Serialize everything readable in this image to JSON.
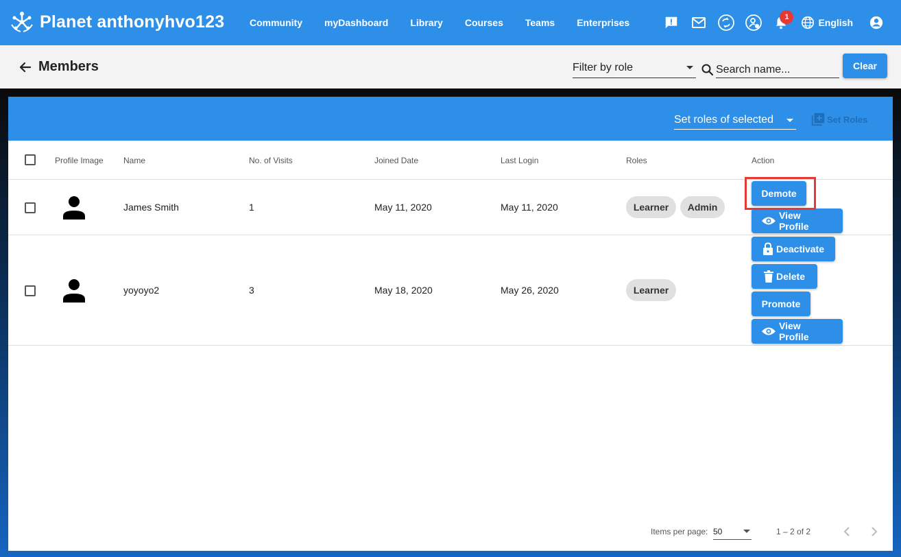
{
  "navbar": {
    "title": "Planet anthonyhvo123",
    "links": [
      "Community",
      "myDashboard",
      "Library",
      "Courses",
      "Teams",
      "Enterprises"
    ],
    "notification_count": "1",
    "language": "English"
  },
  "toolbar": {
    "title": "Members",
    "filter_label": "Filter by role",
    "search_placeholder": "Search name...",
    "clear_label": "Clear"
  },
  "card_header": {
    "set_roles_select": "Set roles of selected",
    "set_roles_button": "Set Roles"
  },
  "table": {
    "headers": [
      "Profile Image",
      "Name",
      "No. of Visits",
      "Joined Date",
      "Last Login",
      "Roles",
      "Action"
    ],
    "rows": [
      {
        "name": "James Smith",
        "visits": "1",
        "joined": "May 11, 2020",
        "last_login": "May 11, 2020",
        "roles": [
          "Learner",
          "Admin"
        ],
        "actions": [
          "Demote",
          "View Profile"
        ]
      },
      {
        "name": "yoyoyo2",
        "visits": "3",
        "joined": "May 18, 2020",
        "last_login": "May 26, 2020",
        "roles": [
          "Learner"
        ],
        "actions": [
          "Deactivate",
          "Delete",
          "Promote",
          "View Profile"
        ]
      }
    ]
  },
  "paginator": {
    "items_label": "Items per page:",
    "page_size": "50",
    "range": "1 – 2 of 2"
  },
  "colors": {
    "primary": "#2d8fe8",
    "highlight": "#e53935"
  }
}
